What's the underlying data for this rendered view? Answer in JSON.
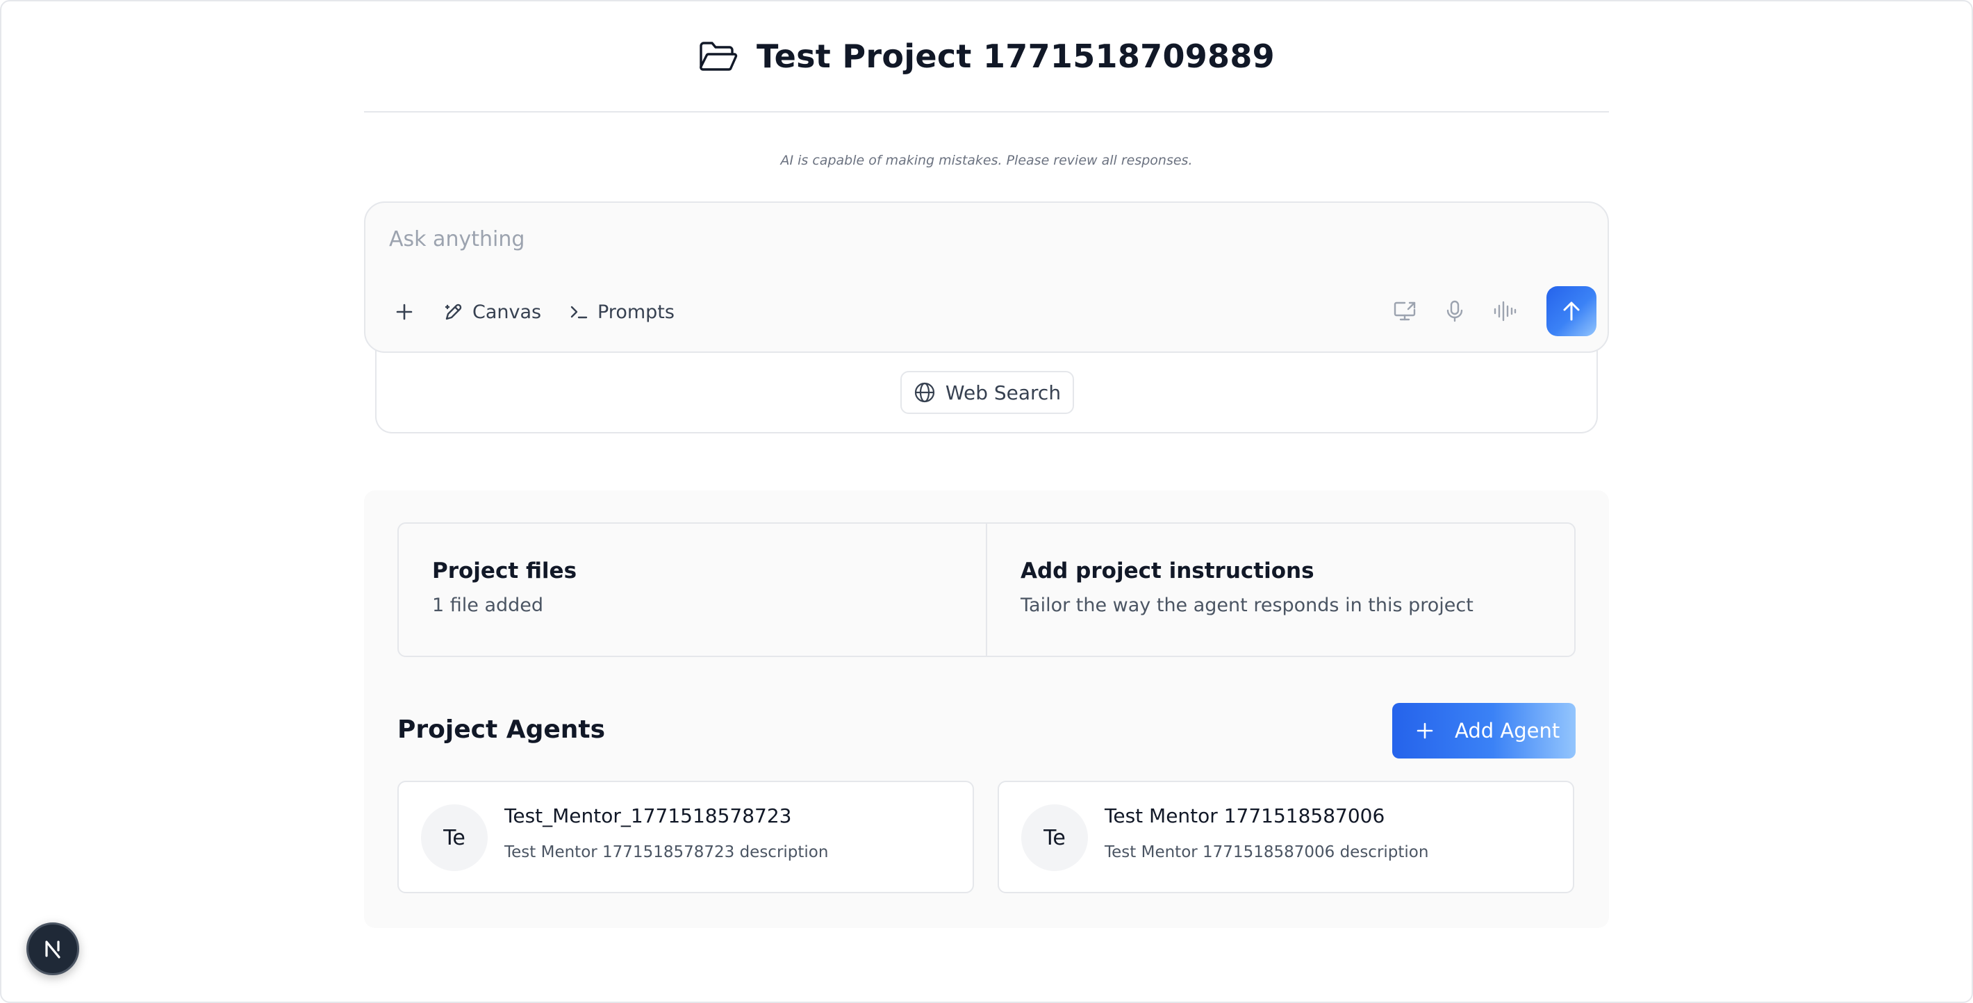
{
  "header": {
    "title": "Test Project 1771518709889",
    "icon": "folder-open-icon"
  },
  "disclaimer": "AI is capable of making mistakes. Please review all responses.",
  "composer": {
    "placeholder": "Ask anything",
    "value": "",
    "tools": {
      "canvas_label": "Canvas",
      "prompts_label": "Prompts"
    },
    "web_search_label": "Web Search"
  },
  "project": {
    "files": {
      "title": "Project files",
      "subtitle": "1 file added"
    },
    "instructions": {
      "title": "Add project instructions",
      "subtitle": "Tailor the way the agent responds in this project"
    },
    "agents_heading": "Project Agents",
    "add_agent_label": "Add Agent",
    "agents": [
      {
        "initials": "Te",
        "name": "Test_Mentor_1771518578723",
        "description": "Test Mentor 1771518578723 description"
      },
      {
        "initials": "Te",
        "name": "Test Mentor 1771518587006",
        "description": "Test Mentor 1771518587006 description"
      }
    ]
  },
  "badge": {
    "letter": "N"
  },
  "colors": {
    "accent": "#2563eb",
    "accent_light": "#93c5fd",
    "border": "#e5e7eb",
    "panel": "#fafafa"
  }
}
